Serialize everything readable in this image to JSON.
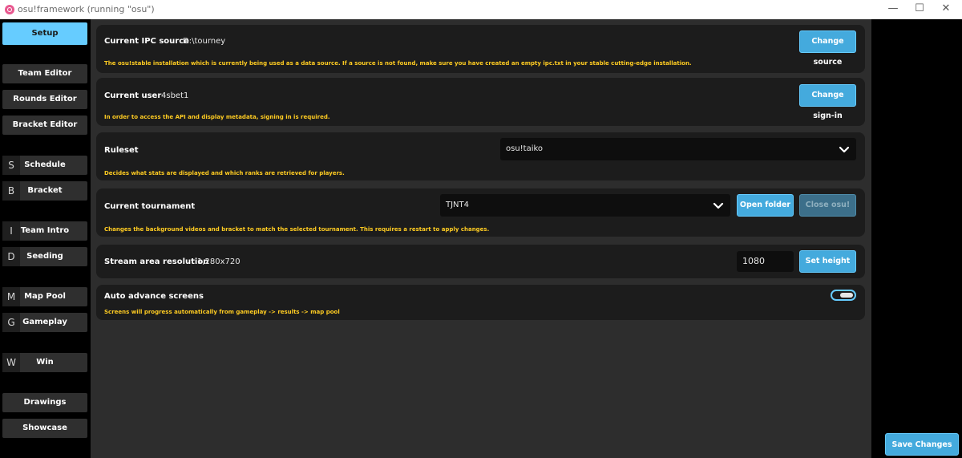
{
  "window": {
    "title": "osu!framework (running \"osu\")",
    "minimize_icon": "minimize-icon",
    "maximize_icon": "maximize-icon",
    "close_icon": "close-icon"
  },
  "sidebar": {
    "items": [
      {
        "label": "Setup",
        "letter": "",
        "active": true
      },
      {
        "label": "Team Editor",
        "letter": ""
      },
      {
        "label": "Rounds Editor",
        "letter": ""
      },
      {
        "label": "Bracket Editor",
        "letter": ""
      },
      {
        "label": "Schedule",
        "letter": "S"
      },
      {
        "label": "Bracket",
        "letter": "B"
      },
      {
        "label": "Team Intro",
        "letter": "I"
      },
      {
        "label": "Seeding",
        "letter": "D"
      },
      {
        "label": "Map Pool",
        "letter": "M"
      },
      {
        "label": "Gameplay",
        "letter": "G"
      },
      {
        "label": "Win",
        "letter": "W"
      },
      {
        "label": "Drawings",
        "letter": ""
      },
      {
        "label": "Showcase",
        "letter": ""
      }
    ]
  },
  "settings": {
    "ipc": {
      "label": "Current IPC source",
      "value": "D:\\tourney",
      "button": "Change source",
      "description": "The osu!stable installation which is currently being used as a data source. If a source is not found, make sure you have created an empty ipc.txt in your stable cutting-edge installation."
    },
    "user": {
      "label": "Current user",
      "value": "4sbet1",
      "button": "Change sign-in",
      "description": "In order to access the API and display metadata, signing in is required."
    },
    "ruleset": {
      "label": "Ruleset",
      "selected": "osu!taiko",
      "description": "Decides what stats are displayed and which ranks are retrieved for players."
    },
    "tournament": {
      "label": "Current tournament",
      "selected": "TJNT4",
      "open_button": "Open folder",
      "close_button": "Close osu!",
      "description": "Changes the background videos and bracket to match the selected tournament. This requires a restart to apply changes."
    },
    "resolution": {
      "label": "Stream area resolution",
      "value": "1,280x720",
      "height_value": "1080",
      "button": "Set height"
    },
    "auto_advance": {
      "label": "Auto advance screens",
      "enabled": true,
      "description": "Screens will progress automatically from gameplay -> results -> map pool"
    }
  },
  "footer": {
    "save_button": "Save Changes"
  },
  "colors": {
    "accent": "#66ccff",
    "button": "#44aadd",
    "description_text": "#ffcc22",
    "card_bg": "#1c1c1c",
    "main_bg": "#2d2d2d"
  }
}
